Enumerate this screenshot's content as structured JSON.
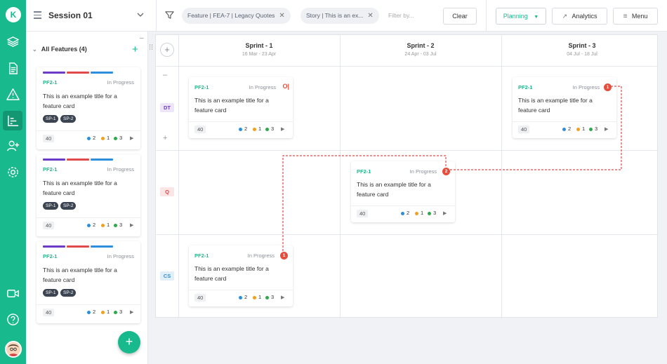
{
  "rail": {
    "logo": "K",
    "icons": [
      "layers-icon",
      "document-icon",
      "warning-icon",
      "chart-icon",
      "user-add-icon",
      "gear-icon",
      "video-icon",
      "help-icon"
    ]
  },
  "header": {
    "session_title": "Session 01",
    "filters": [
      {
        "label": "Feature | FEA-7 | Legacy Quotes"
      },
      {
        "label": "Story | This is an ex..."
      }
    ],
    "filter_placeholder": "Filter by...",
    "clear_label": "Clear",
    "planning_label": "Planning",
    "analytics_label": "Analytics",
    "menu_label": "Menu"
  },
  "sidebar": {
    "heading": "All Features (4)",
    "cards": [
      {
        "id": "PF2-1",
        "status": "In Progress",
        "title_line1": "This is an example title for a",
        "title_line2": "feature card",
        "tags": [
          "SP-1",
          "SP-2"
        ],
        "points": "40",
        "counts": [
          "2",
          "1",
          "3"
        ]
      },
      {
        "id": "PF2-1",
        "status": "In Progress",
        "title_line1": "This is an example title for a",
        "title_line2": "feature card",
        "tags": [
          "SP-1",
          "SP-2"
        ],
        "points": "40",
        "counts": [
          "2",
          "1",
          "3"
        ]
      },
      {
        "id": "PF2-1",
        "status": "In Progress",
        "title_line1": "This is an example title for a",
        "title_line2": "feature card",
        "tags": [
          "SP-1",
          "SP-2"
        ],
        "points": "40",
        "counts": [
          "2",
          "1",
          "3"
        ]
      }
    ],
    "bar_colors": [
      "#6c3bc7",
      "#e04a4a",
      "#2d8fdc"
    ]
  },
  "board": {
    "sprints": [
      {
        "name": "Sprint - 1",
        "dates": "16 Mar - 23 Apr"
      },
      {
        "name": "Sprint - 2",
        "dates": "24 Apr - 03 Jul"
      },
      {
        "name": "Sprint - 3",
        "dates": "04 Jul - 18 Jul"
      }
    ],
    "rows": [
      {
        "label": "DT",
        "color": "#6c3bc7",
        "bg": "#ece6f8"
      },
      {
        "label": "Q",
        "color": "#e04a4a",
        "bg": "#fbe5e5"
      },
      {
        "label": "CS",
        "color": "#2d8fdc",
        "bg": "#e1effb"
      }
    ],
    "cards": [
      {
        "id": "PF2-1",
        "status": "In Progress",
        "title_line1": "This is an example title for a",
        "title_line2": "feature card",
        "points": "40",
        "counts": [
          "2",
          "1",
          "3"
        ],
        "marker": "link"
      },
      {
        "id": "PF2-1",
        "status": "In Progress",
        "title_line1": "This is an example title for a",
        "title_line2": "feature card",
        "points": "40",
        "counts": [
          "2",
          "1",
          "3"
        ],
        "marker": "1"
      },
      {
        "id": "PF2-1",
        "status": "In Progress",
        "title_line1": "This is an example title for a",
        "title_line2": "feature card",
        "points": "40",
        "counts": [
          "2",
          "1",
          "3"
        ],
        "marker": "2"
      },
      {
        "id": "PF2-1",
        "status": "In Progress",
        "title_line1": "This is an example title for a",
        "title_line2": "feature card",
        "points": "40",
        "counts": [
          "2",
          "1",
          "3"
        ],
        "marker": "1"
      }
    ],
    "count_colors": [
      "#2d8fdc",
      "#f0a020",
      "#2ea84a"
    ],
    "dependency_color": "#e04a4a"
  }
}
